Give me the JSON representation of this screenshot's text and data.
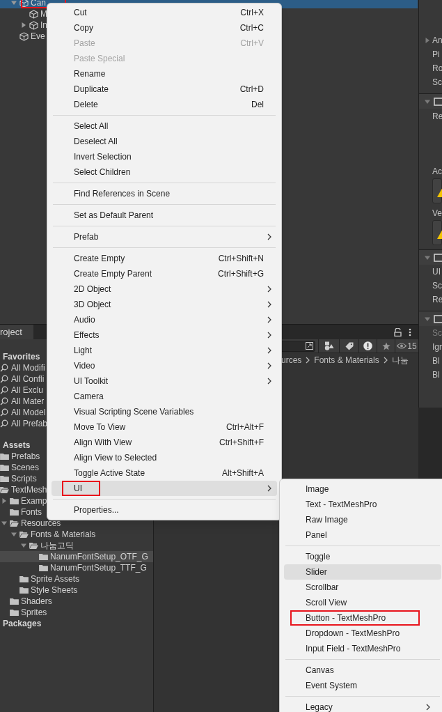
{
  "hierarchy": {
    "items": [
      {
        "label": "Can",
        "expanded": true,
        "selected": true,
        "annotated": true,
        "children": [
          {
            "label": "M",
            "selected": false
          },
          {
            "label": "In",
            "expanded": false,
            "selected": false
          }
        ]
      },
      {
        "label": "Eve",
        "selected": false
      }
    ]
  },
  "inspector": {
    "rows": [
      {
        "kind": "foldout",
        "label": "An",
        "expanded": false
      },
      {
        "kind": "label",
        "label": "Pi"
      },
      {
        "kind": "label",
        "label": "Ro"
      },
      {
        "kind": "label",
        "label": "Sc"
      },
      {
        "kind": "header",
        "expanded": true
      },
      {
        "kind": "area",
        "label": "Re"
      },
      {
        "kind": "label",
        "label": "Ac"
      },
      {
        "kind": "warning"
      },
      {
        "kind": "label",
        "label": "Ve"
      },
      {
        "kind": "warning"
      },
      {
        "kind": "header",
        "expanded": true
      },
      {
        "kind": "label",
        "label": "UI"
      },
      {
        "kind": "label",
        "label": "Sc"
      },
      {
        "kind": "label",
        "label": "Re"
      },
      {
        "kind": "header",
        "expanded": true
      },
      {
        "kind": "dim",
        "label": "Sc"
      },
      {
        "kind": "label",
        "label": "Igr"
      },
      {
        "kind": "label",
        "label": "Bl"
      },
      {
        "kind": "label",
        "label": "Bl"
      }
    ]
  },
  "project": {
    "tab": "roject",
    "favorites": {
      "title": "Favorites",
      "items": [
        "All Modifi",
        "All Confli",
        "All Exclu",
        "All Mater",
        "All Model",
        "All Prefab"
      ]
    },
    "assets": {
      "title": "Assets",
      "items": [
        {
          "label": "Prefabs",
          "selected": false
        },
        {
          "label": "Scenes",
          "selected": false
        },
        {
          "label": "Scripts",
          "selected": false
        },
        {
          "label": "TextMesh",
          "expanded": true,
          "selected": false,
          "children": [
            {
              "label": "Examp",
              "expanded": false,
              "selected": false
            },
            {
              "label": "Fonts",
              "selected": false
            },
            {
              "label": "Resources",
              "expanded": true,
              "selected": false,
              "children": [
                {
                  "label": "Fonts & Materials",
                  "expanded": true,
                  "selected": false,
                  "children": [
                    {
                      "label": "나눔고딕",
                      "expanded": true,
                      "selected": false,
                      "children": [
                        {
                          "label": "NanumFontSetup_OTF_G",
                          "selected": true
                        },
                        {
                          "label": "NanumFontSetup_TTF_G",
                          "selected": false
                        }
                      ]
                    }
                  ]
                },
                {
                  "label": "Sprite Assets",
                  "selected": false
                },
                {
                  "label": "Style Sheets",
                  "selected": false
                }
              ]
            },
            {
              "label": "Shaders",
              "selected": false
            },
            {
              "label": "Sprites",
              "selected": false
            }
          ]
        }
      ]
    },
    "packages": {
      "title": "Packages"
    },
    "filter_count": "15",
    "breadcrumb": [
      "urces",
      "Fonts & Materials",
      "나눔"
    ]
  },
  "context_menu": {
    "items": [
      {
        "kind": "item",
        "label": "Cut",
        "shortcut": "Ctrl+X",
        "disabled": false,
        "submenu": false,
        "selected": false
      },
      {
        "kind": "item",
        "label": "Copy",
        "shortcut": "Ctrl+C",
        "disabled": false,
        "submenu": false,
        "selected": false
      },
      {
        "kind": "item",
        "label": "Paste",
        "shortcut": "Ctrl+V",
        "disabled": true,
        "submenu": false,
        "selected": false
      },
      {
        "kind": "item",
        "label": "Paste Special",
        "disabled": true,
        "submenu": false,
        "selected": false
      },
      {
        "kind": "item",
        "label": "Rename",
        "disabled": false,
        "submenu": false,
        "selected": false
      },
      {
        "kind": "item",
        "label": "Duplicate",
        "shortcut": "Ctrl+D",
        "disabled": false,
        "submenu": false,
        "selected": false
      },
      {
        "kind": "item",
        "label": "Delete",
        "shortcut": "Del",
        "disabled": false,
        "submenu": false,
        "selected": false
      },
      {
        "kind": "separator"
      },
      {
        "kind": "item",
        "label": "Select All",
        "disabled": false,
        "submenu": false,
        "selected": false
      },
      {
        "kind": "item",
        "label": "Deselect All",
        "disabled": false,
        "submenu": false,
        "selected": false
      },
      {
        "kind": "item",
        "label": "Invert Selection",
        "disabled": false,
        "submenu": false,
        "selected": false
      },
      {
        "kind": "item",
        "label": "Select Children",
        "disabled": false,
        "submenu": false,
        "selected": false
      },
      {
        "kind": "separator"
      },
      {
        "kind": "item",
        "label": "Find References in Scene",
        "disabled": false,
        "submenu": false,
        "selected": false
      },
      {
        "kind": "separator"
      },
      {
        "kind": "item",
        "label": "Set as Default Parent",
        "disabled": false,
        "submenu": false,
        "selected": false
      },
      {
        "kind": "separator"
      },
      {
        "kind": "item",
        "label": "Prefab",
        "disabled": false,
        "submenu": true,
        "selected": false
      },
      {
        "kind": "separator"
      },
      {
        "kind": "item",
        "label": "Create Empty",
        "shortcut": "Ctrl+Shift+N",
        "disabled": false,
        "submenu": false,
        "selected": false
      },
      {
        "kind": "item",
        "label": "Create Empty Parent",
        "shortcut": "Ctrl+Shift+G",
        "disabled": false,
        "submenu": false,
        "selected": false
      },
      {
        "kind": "item",
        "label": "2D Object",
        "disabled": false,
        "submenu": true,
        "selected": false
      },
      {
        "kind": "item",
        "label": "3D Object",
        "disabled": false,
        "submenu": true,
        "selected": false
      },
      {
        "kind": "item",
        "label": "Audio",
        "disabled": false,
        "submenu": true,
        "selected": false
      },
      {
        "kind": "item",
        "label": "Effects",
        "disabled": false,
        "submenu": true,
        "selected": false
      },
      {
        "kind": "item",
        "label": "Light",
        "disabled": false,
        "submenu": true,
        "selected": false
      },
      {
        "kind": "item",
        "label": "Video",
        "disabled": false,
        "submenu": true,
        "selected": false
      },
      {
        "kind": "item",
        "label": "UI Toolkit",
        "disabled": false,
        "submenu": true,
        "selected": false
      },
      {
        "kind": "item",
        "label": "Camera",
        "disabled": false,
        "submenu": false,
        "selected": false
      },
      {
        "kind": "item",
        "label": "Visual Scripting Scene Variables",
        "disabled": false,
        "submenu": false,
        "selected": false
      },
      {
        "kind": "item",
        "label": "Move To View",
        "shortcut": "Ctrl+Alt+F",
        "disabled": false,
        "submenu": false,
        "selected": false
      },
      {
        "kind": "item",
        "label": "Align With View",
        "shortcut": "Ctrl+Shift+F",
        "disabled": false,
        "submenu": false,
        "selected": false
      },
      {
        "kind": "item",
        "label": "Align View to Selected",
        "disabled": false,
        "submenu": false,
        "selected": false
      },
      {
        "kind": "item",
        "label": "Toggle Active State",
        "shortcut": "Alt+Shift+A",
        "disabled": false,
        "submenu": false,
        "selected": false
      },
      {
        "kind": "item",
        "label": "UI",
        "disabled": false,
        "submenu": true,
        "selected": true,
        "annotated": true
      },
      {
        "kind": "separator"
      },
      {
        "kind": "item",
        "label": "Properties...",
        "disabled": false,
        "submenu": false,
        "selected": false
      }
    ]
  },
  "ui_submenu": {
    "items": [
      {
        "kind": "item",
        "label": "Image",
        "disabled": false,
        "submenu": false,
        "selected": false
      },
      {
        "kind": "item",
        "label": "Text - TextMeshPro",
        "disabled": false,
        "submenu": false,
        "selected": false
      },
      {
        "kind": "item",
        "label": "Raw Image",
        "disabled": false,
        "submenu": false,
        "selected": false
      },
      {
        "kind": "item",
        "label": "Panel",
        "disabled": false,
        "submenu": false,
        "selected": false
      },
      {
        "kind": "separator"
      },
      {
        "kind": "item",
        "label": "Toggle",
        "disabled": false,
        "submenu": false,
        "selected": false
      },
      {
        "kind": "item",
        "label": "Slider",
        "disabled": false,
        "submenu": false,
        "selected": true
      },
      {
        "kind": "item",
        "label": "Scrollbar",
        "disabled": false,
        "submenu": false,
        "selected": false
      },
      {
        "kind": "item",
        "label": "Scroll View",
        "disabled": false,
        "submenu": false,
        "selected": false
      },
      {
        "kind": "item",
        "label": "Button - TextMeshPro",
        "disabled": false,
        "submenu": false,
        "selected": false,
        "annotated": true
      },
      {
        "kind": "item",
        "label": "Dropdown - TextMeshPro",
        "disabled": false,
        "submenu": false,
        "selected": false
      },
      {
        "kind": "item",
        "label": "Input Field - TextMeshPro",
        "disabled": false,
        "submenu": false,
        "selected": false
      },
      {
        "kind": "separator"
      },
      {
        "kind": "item",
        "label": "Canvas",
        "disabled": false,
        "submenu": false,
        "selected": false
      },
      {
        "kind": "item",
        "label": "Event System",
        "disabled": false,
        "submenu": false,
        "selected": false
      },
      {
        "kind": "separator"
      },
      {
        "kind": "item",
        "label": "Legacy",
        "disabled": false,
        "submenu": true,
        "selected": false
      }
    ]
  }
}
